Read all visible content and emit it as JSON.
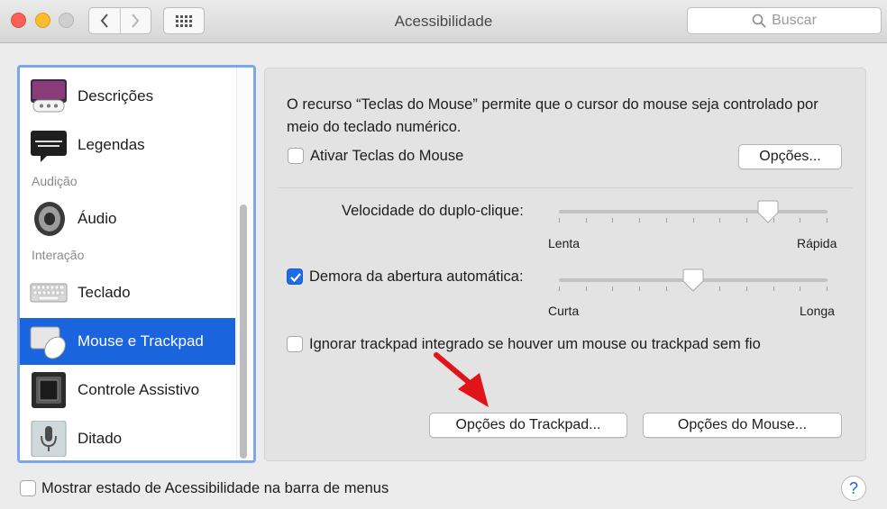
{
  "window": {
    "title": "Acessibilidade"
  },
  "search": {
    "placeholder": "Buscar"
  },
  "sidebar": {
    "items": [
      {
        "label": "Descrições",
        "icon": "descriptions-icon"
      },
      {
        "label": "Legendas",
        "icon": "captions-icon"
      },
      {
        "section": "Audição"
      },
      {
        "label": "Áudio",
        "icon": "speaker-icon"
      },
      {
        "section": "Interação"
      },
      {
        "label": "Teclado",
        "icon": "keyboard-icon"
      },
      {
        "label": "Mouse e Trackpad",
        "icon": "mouse-trackpad-icon",
        "selected": true
      },
      {
        "label": "Controle Assistivo",
        "icon": "switch-control-icon"
      },
      {
        "label": "Ditado",
        "icon": "microphone-icon"
      }
    ]
  },
  "main": {
    "description": "O recurso “Teclas do Mouse” permite que o cursor do mouse seja controlado por meio do teclado numérico.",
    "mouse_keys": {
      "label": "Ativar Teclas do Mouse",
      "checked": false,
      "options_button": "Opções..."
    },
    "double_click": {
      "label": "Velocidade do duplo-clique:",
      "min_label": "Lenta",
      "max_label": "Rápida",
      "value_fraction": 0.78
    },
    "spring_loading": {
      "label": "Demora da abertura automática:",
      "checked": true,
      "min_label": "Curta",
      "max_label": "Longa",
      "value_fraction": 0.5
    },
    "ignore_trackpad": {
      "label": "Ignorar trackpad integrado se houver um mouse ou trackpad sem fio",
      "checked": false
    },
    "trackpad_options_button": "Opções do Trackpad...",
    "mouse_options_button": "Opções do Mouse..."
  },
  "footer": {
    "show_status_label": "Mostrar estado de Acessibilidade na barra de menus",
    "checked": false,
    "help": "?"
  },
  "colors": {
    "accent": "#1a64dd",
    "annotation_arrow": "#e0141a"
  }
}
